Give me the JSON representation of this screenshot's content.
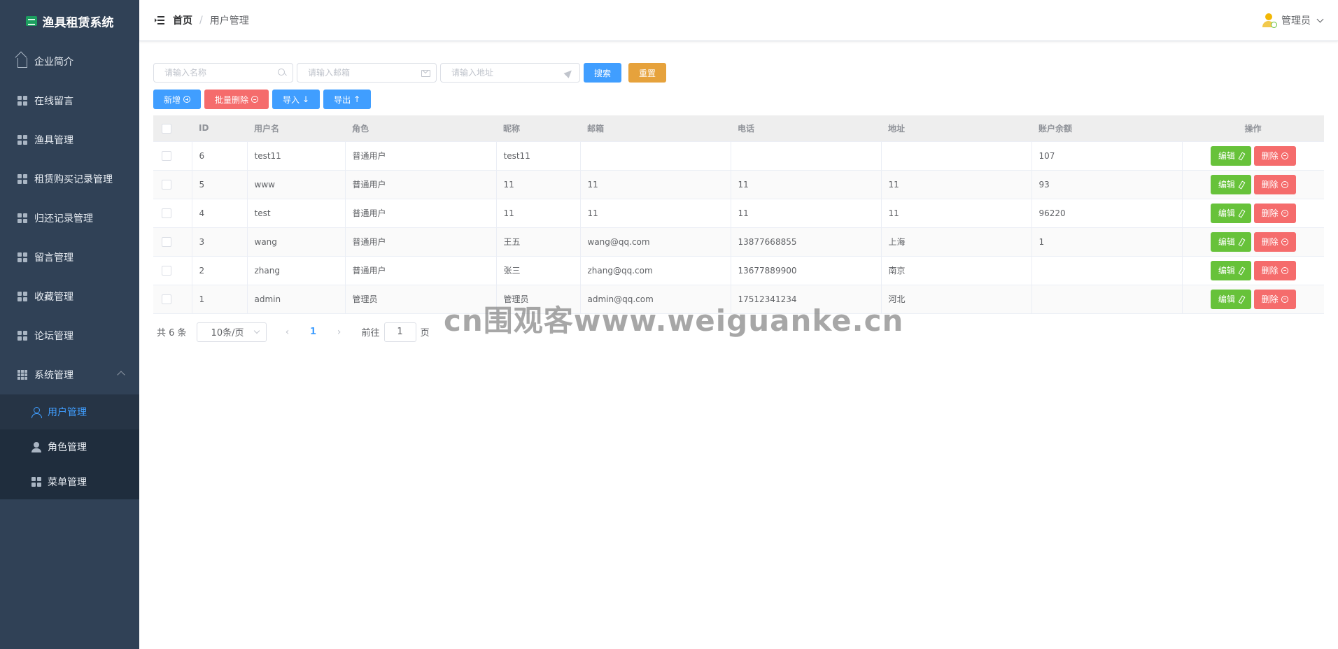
{
  "app": {
    "title": "渔具租赁系统"
  },
  "sidebar": {
    "items": [
      {
        "label": "企业简介",
        "icon": "home-icon"
      },
      {
        "label": "在线留言",
        "icon": "grid-icon"
      },
      {
        "label": "渔具管理",
        "icon": "grid-icon"
      },
      {
        "label": "租赁购买记录管理",
        "icon": "grid-icon"
      },
      {
        "label": "归还记录管理",
        "icon": "grid-icon"
      },
      {
        "label": "留言管理",
        "icon": "grid-icon"
      },
      {
        "label": "收藏管理",
        "icon": "grid-icon"
      },
      {
        "label": "论坛管理",
        "icon": "grid-icon"
      },
      {
        "label": "系统管理",
        "icon": "grid9-icon"
      }
    ],
    "submenu": [
      {
        "label": "用户管理",
        "icon": "user-icon",
        "active": true
      },
      {
        "label": "角色管理",
        "icon": "user-solid-icon"
      },
      {
        "label": "菜单管理",
        "icon": "grid-icon"
      }
    ]
  },
  "header": {
    "breadcrumb_home": "首页",
    "breadcrumb_sep": "/",
    "breadcrumb_current": "用户管理",
    "user_name": "管理员"
  },
  "search": {
    "name_placeholder": "请输入名称",
    "email_placeholder": "请输入邮箱",
    "address_placeholder": "请输入地址",
    "search_label": "搜索",
    "reset_label": "重置"
  },
  "toolbar": {
    "add_label": "新增",
    "batch_delete_label": "批量删除",
    "import_label": "导入",
    "export_label": "导出"
  },
  "table": {
    "columns": [
      "ID",
      "用户名",
      "角色",
      "昵称",
      "邮箱",
      "电话",
      "地址",
      "账户余额",
      "操作"
    ],
    "edit_label": "编辑",
    "delete_label": "删除",
    "rows": [
      {
        "id": "6",
        "username": "test11",
        "role": "普通用户",
        "nickname": "test11",
        "email": "",
        "phone": "",
        "address": "",
        "balance": "107"
      },
      {
        "id": "5",
        "username": "www",
        "role": "普通用户",
        "nickname": "11",
        "email": "11",
        "phone": "11",
        "address": "11",
        "balance": "93"
      },
      {
        "id": "4",
        "username": "test",
        "role": "普通用户",
        "nickname": "11",
        "email": "11",
        "phone": "11",
        "address": "11",
        "balance": "96220"
      },
      {
        "id": "3",
        "username": "wang",
        "role": "普通用户",
        "nickname": "王五",
        "email": "wang@qq.com",
        "phone": "13877668855",
        "address": "上海",
        "balance": "1"
      },
      {
        "id": "2",
        "username": "zhang",
        "role": "普通用户",
        "nickname": "张三",
        "email": "zhang@qq.com",
        "phone": "13677889900",
        "address": "南京",
        "balance": ""
      },
      {
        "id": "1",
        "username": "admin",
        "role": "管理员",
        "nickname": "管理员",
        "email": "admin@qq.com",
        "phone": "17512341234",
        "address": "河北",
        "balance": ""
      }
    ]
  },
  "pagination": {
    "total_text": "共 6 条",
    "page_size": "10条/页",
    "prev": "‹",
    "current_page": "1",
    "next": "›",
    "goto_prefix": "前往",
    "goto_value": "1",
    "goto_suffix": "页"
  },
  "watermark": "cn围观客www.weiguanke.cn",
  "colors": {
    "sidebar_bg": "#304156",
    "primary": "#409eff",
    "success": "#67c23a",
    "danger": "#f56c6c",
    "warning": "#e6a23c"
  }
}
